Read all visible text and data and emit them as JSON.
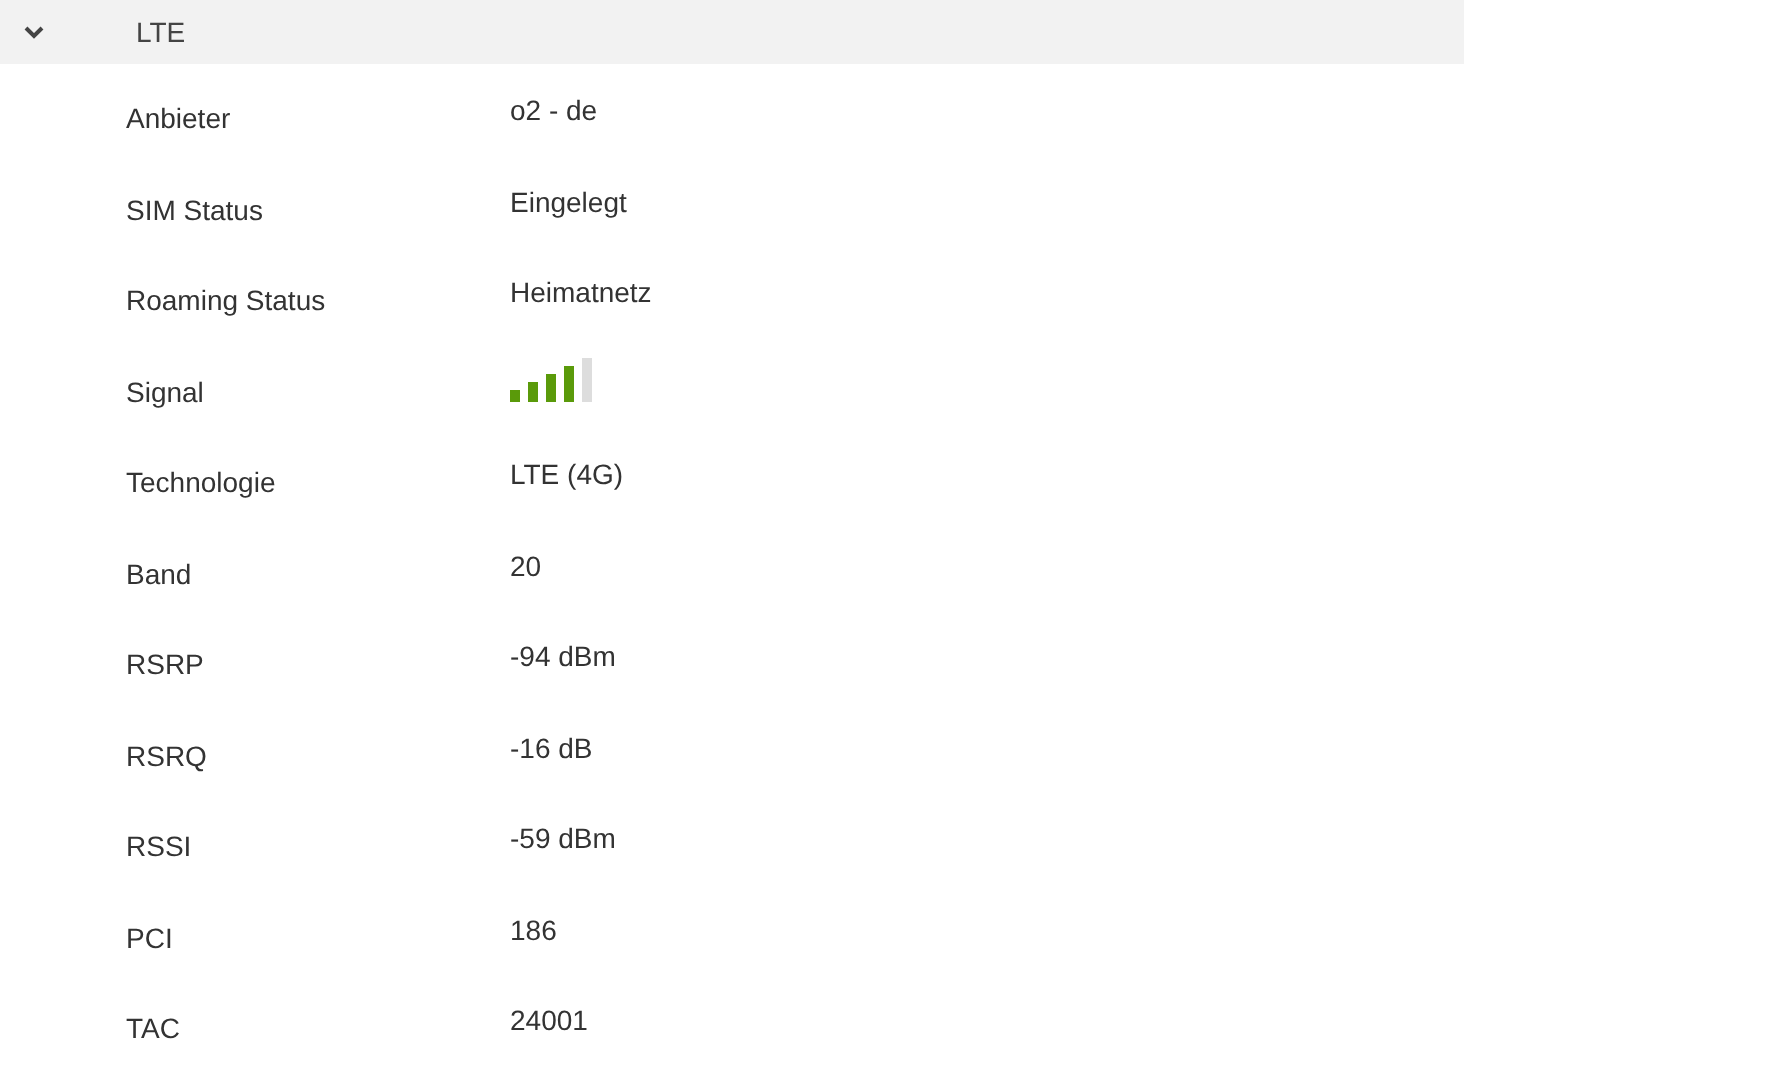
{
  "section": {
    "title": "LTE",
    "expanded": true
  },
  "rows": [
    {
      "label": "Anbieter",
      "kind": "text",
      "value": "o2 - de"
    },
    {
      "label": "SIM Status",
      "kind": "text",
      "value": "Eingelegt"
    },
    {
      "label": "Roaming Status",
      "kind": "text",
      "value": "Heimatnetz"
    },
    {
      "label": "Signal",
      "kind": "signal"
    },
    {
      "label": "Technologie",
      "kind": "text",
      "value": "LTE (4G)"
    },
    {
      "label": "Band",
      "kind": "text",
      "value": "20"
    },
    {
      "label": "RSRP",
      "kind": "text",
      "value": "-94 dBm"
    },
    {
      "label": "RSRQ",
      "kind": "text",
      "value": "-16 dB"
    },
    {
      "label": "RSSI",
      "kind": "text",
      "value": "-59 dBm"
    },
    {
      "label": "PCI",
      "kind": "text",
      "value": "186"
    },
    {
      "label": "TAC",
      "kind": "text",
      "value": "24001"
    }
  ]
}
